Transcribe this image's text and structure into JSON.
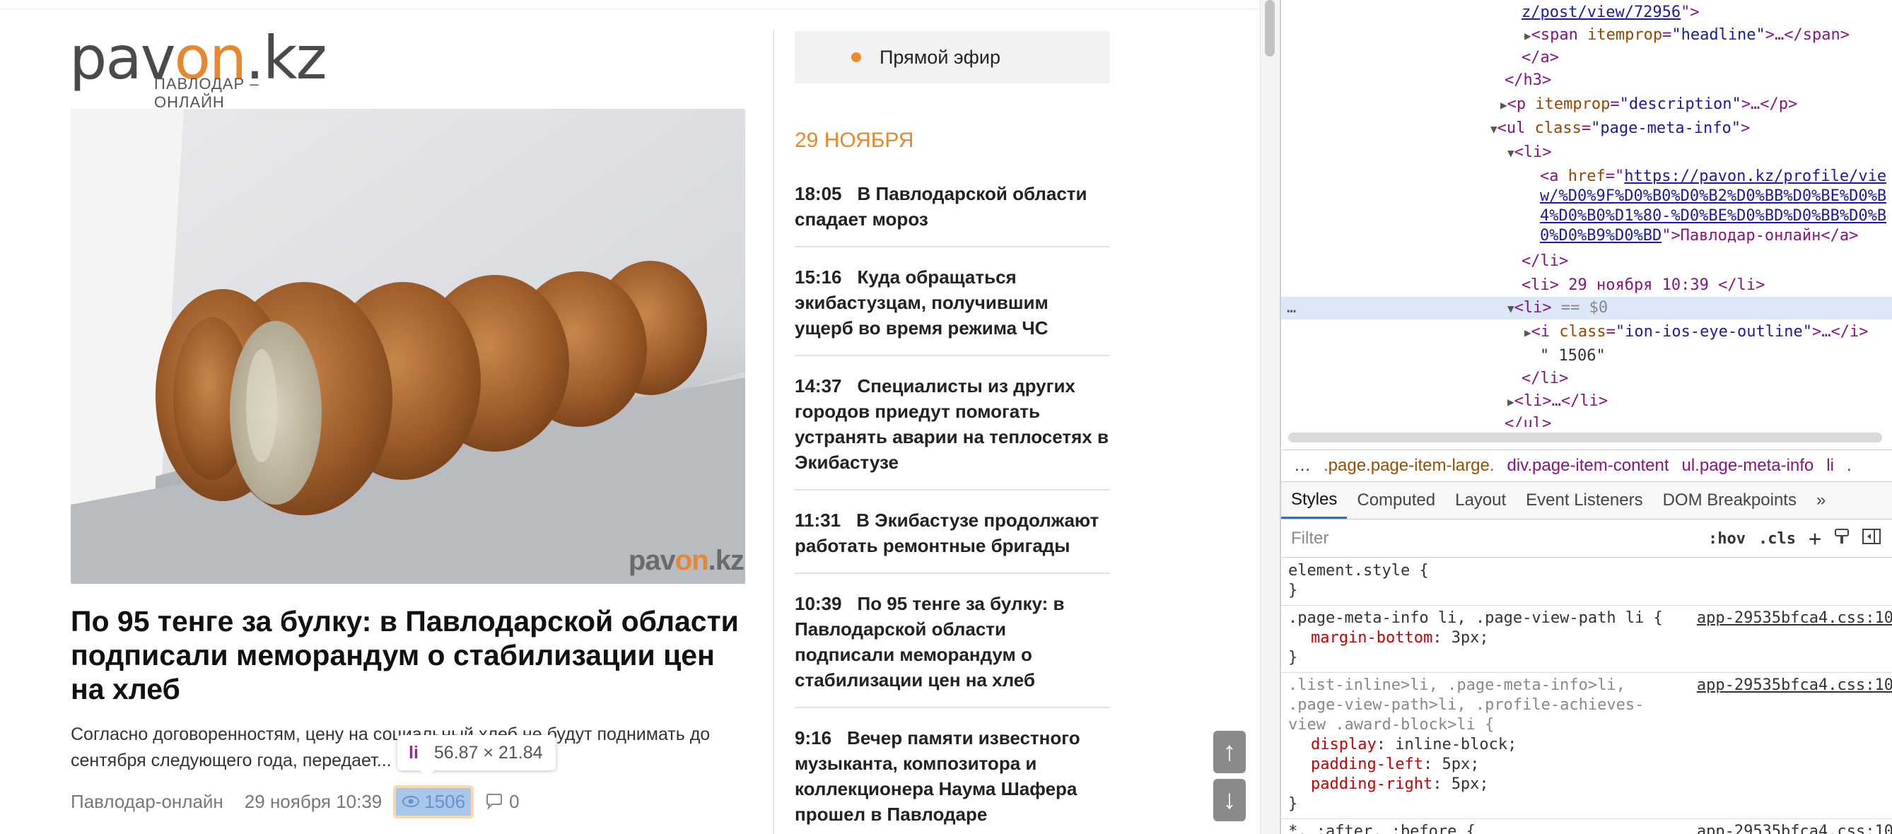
{
  "site": {
    "logo": {
      "pre": "pav",
      "accent": "on",
      "post": ".kz",
      "tagline": "ПАВЛОДАР – ОНЛАЙН"
    },
    "watermark": {
      "pre": "pav",
      "accent": "on",
      "post": ".kz"
    },
    "article": {
      "title": "По 95 тенге за булку: в Павлодарской области подписали меморандум о стабилизации цен на хлеб",
      "description": "Согласно договоренностям, цену на социальный хлеб не будут поднимать до сентября следующего года, передает...",
      "author": "Павлодар-онлайн",
      "date": "29 ноября 10:39",
      "views": "1506",
      "comments": "0"
    },
    "tooltip": {
      "tag": "li",
      "dims": "56.87 × 21.84"
    },
    "live_label": "Прямой эфир",
    "day_heading": "29 НОЯБРЯ",
    "news": [
      {
        "time": "18:05",
        "title": "В Павлодарской области спадает мороз"
      },
      {
        "time": "15:16",
        "title": "Куда обращаться экибастузцам, получившим ущерб во время режима ЧС"
      },
      {
        "time": "14:37",
        "title": "Специалисты из других городов приедут помогать устранять аварии на теплосетях в Экибастузе"
      },
      {
        "time": "11:31",
        "title": "В Экибастузе продолжают работать ремонтные бригады"
      },
      {
        "time": "10:39",
        "title": "По 95 тенге за булку: в Павлодарской области подписали меморандум о стабилизации цен на хлеб"
      },
      {
        "time": "9:16",
        "title": "Вечер памяти известного музыканта, композитора и коллекционера Наума Шафера прошел в Павлодаре"
      }
    ],
    "scroll_up": "↑",
    "scroll_down": "↓"
  },
  "devtools": {
    "dom": {
      "l1_link": "z/post/view/72956",
      "l1_end": "\">",
      "l2_tag": "<span ",
      "l2_attr": "itemprop",
      "l2_val": "\"headline\"",
      "l2_end": ">…</span>",
      "l3": "</a>",
      "l4": "</h3>",
      "l5_tag": "<p ",
      "l5_attr": "itemprop",
      "l5_val": "\"description\"",
      "l5_end": ">…</p>",
      "l6_tag": "<ul ",
      "l6_attr": "class",
      "l6_val": "\"page-meta-info\"",
      "l6_end": ">",
      "l7": "<li>",
      "l8_tag": "<a ",
      "l8_attr": "href",
      "l8_link1": "https://pavon.kz/profile/vie",
      "l9_link": "w/%D0%9F%D0%B0%D0%B2%D0%BB%D0%BE%D0%B",
      "l10_link": "4%D0%B0%D1%80-%D0%BE%D0%BD%D0%BB%D0%B",
      "l11_link": "0%D0%B9%D0%BD",
      "l11_rest": "\">Павлодар-онлайн</a>",
      "l12": "</li>",
      "l13": "<li> 29 ноября 10:39 </li>",
      "l14_dots": "…",
      "l14_tag": "<li>",
      "l14_sel": " == $0",
      "l15_tag": "<i ",
      "l15_attr": "class",
      "l15_val": "\"ion-ios-eye-outline\"",
      "l15_end": ">…</i>",
      "l16": "\" 1506\"",
      "l17": "</li>",
      "l18": "<li>…</li>",
      "l19": "</ul>"
    },
    "breadcrumbs": [
      "…",
      ".page.page-item-large.",
      "div.page-item-content",
      "ul.page-meta-info",
      "li",
      "."
    ],
    "tabs": [
      "Styles",
      "Computed",
      "Layout",
      "Event Listeners",
      "DOM Breakpoints",
      "»"
    ],
    "filter_placeholder": "Filter",
    "hov": ":hov",
    "cls": ".cls",
    "rules": [
      {
        "selector": "element.style {",
        "decls": [],
        "close": "}",
        "src": ""
      },
      {
        "selector": ".page-meta-info li, .page-view-path li {",
        "decls": [
          {
            "p": "margin-bottom",
            "v": "3px;"
          }
        ],
        "close": "}",
        "src": "app-29535bfca4.css:10"
      },
      {
        "selector": ".list-inline>li, .page-meta-info>li, .page-view-path>li, .profile-achieves-view .award-block>li {",
        "decls": [
          {
            "p": "display",
            "v": "inline-block;"
          },
          {
            "p": "padding-left",
            "v": "5px;"
          },
          {
            "p": "padding-right",
            "v": "5px;"
          }
        ],
        "close": "}",
        "src": "app-29535bfca4.css:10"
      },
      {
        "selector": "*, :after, :before {",
        "decls": [],
        "close": "",
        "src": "app-29535bfca4.css:10"
      }
    ]
  }
}
